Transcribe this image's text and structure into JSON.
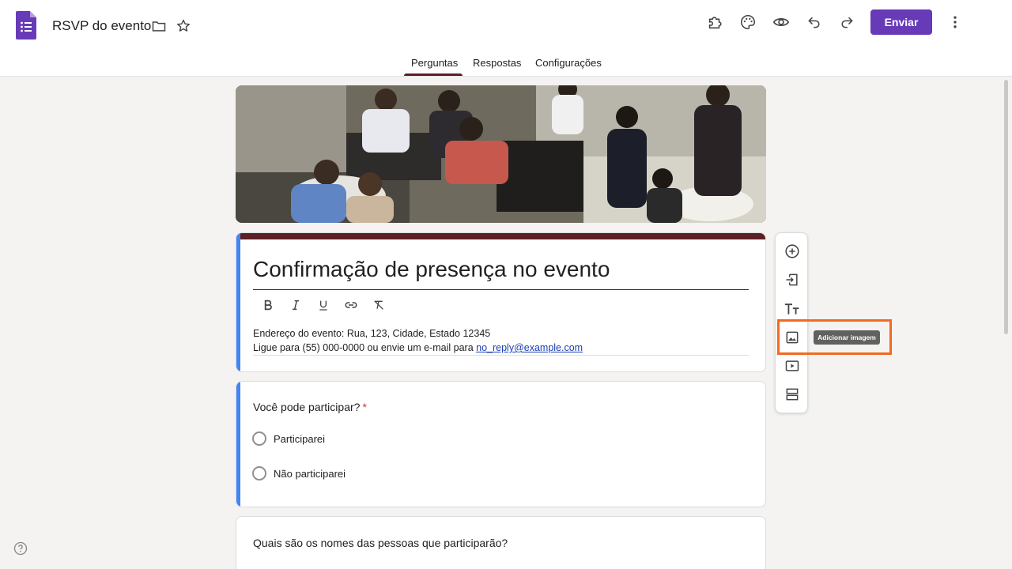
{
  "header": {
    "doc_title": "RSVP do evento",
    "send_label": "Enviar",
    "icons": [
      "forms-logo-icon",
      "folder-icon",
      "star-icon",
      "addons-icon",
      "palette-icon",
      "preview-eye-icon",
      "undo-icon",
      "redo-icon",
      "more-vert-icon"
    ],
    "accent_color": "#673ab7"
  },
  "tabs": [
    {
      "label": "Perguntas",
      "active": true
    },
    {
      "label": "Respostas",
      "active": false
    },
    {
      "label": "Configurações",
      "active": false
    }
  ],
  "form": {
    "title": "Confirmação de presença no evento",
    "format_tools": [
      "bold-icon",
      "italic-icon",
      "underline-icon",
      "link-icon",
      "clear-format-icon"
    ],
    "description_line1": "Endereço do evento: Rua, 123, Cidade, Estado 12345",
    "description_line2_prefix": "Ligue para (55) 000-0000 ou envie um e-mail para ",
    "description_email": "no_reply@example.com",
    "theme_color": "#5b1f24"
  },
  "questions": [
    {
      "title": "Você pode participar?",
      "required_mark": "*",
      "options": [
        "Participarei",
        "Não participarei"
      ]
    },
    {
      "title": "Quais são os nomes das pessoas que participarão?"
    }
  ],
  "side_tools": [
    "add-question-icon",
    "import-questions-icon",
    "add-title-icon",
    "add-image-icon",
    "add-video-icon",
    "add-section-icon"
  ],
  "tooltip": "Adicionar imagem",
  "highlight_color": "#f26a21"
}
